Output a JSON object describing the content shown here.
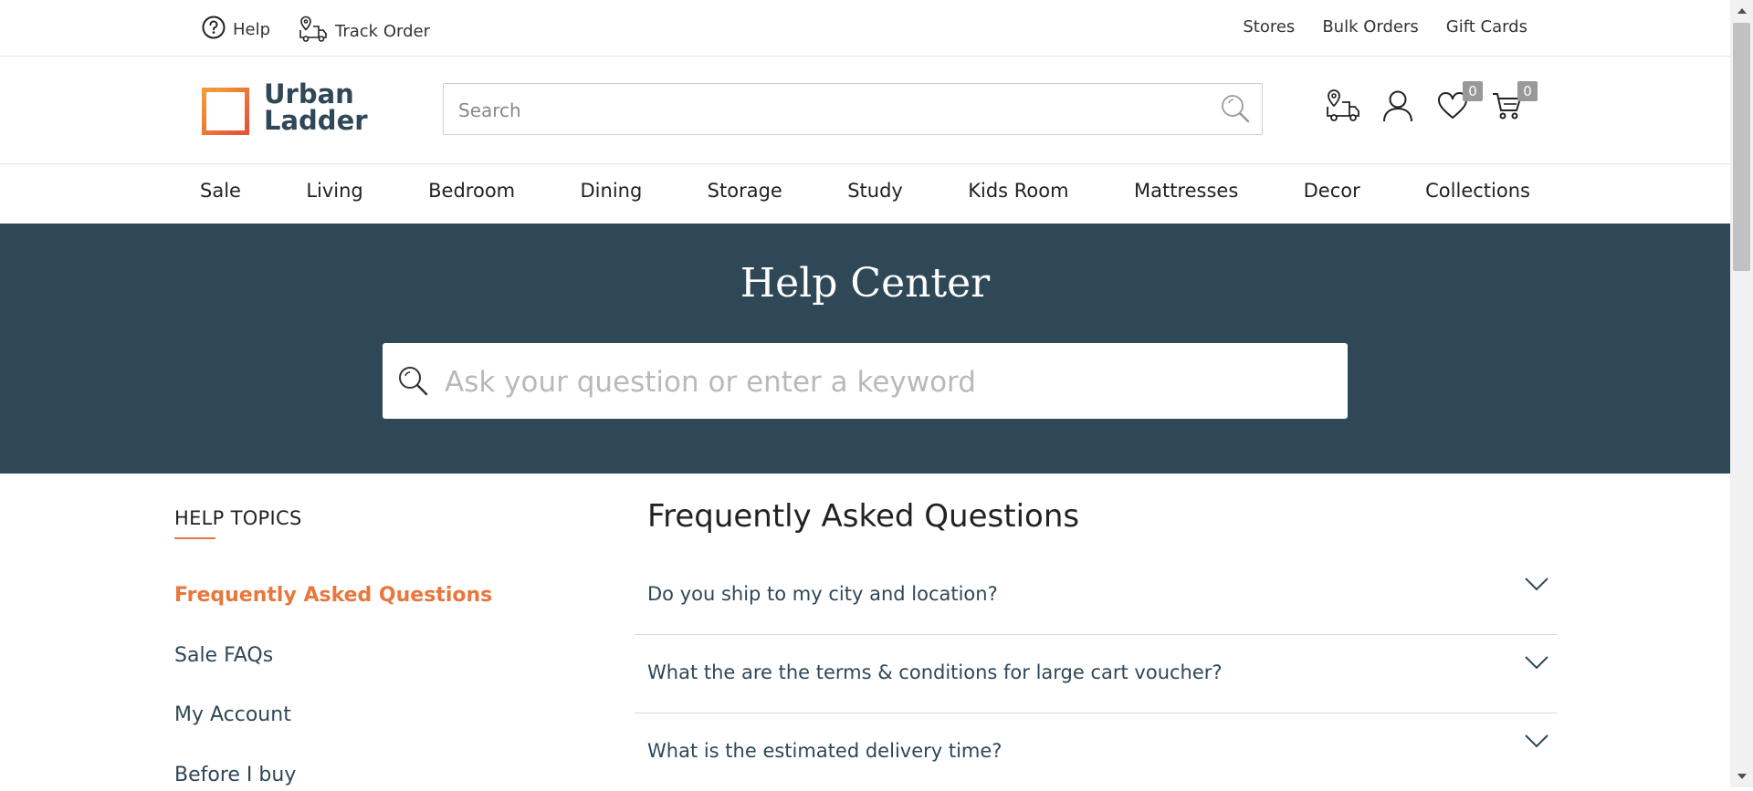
{
  "topbar": {
    "help_label": "Help",
    "track_order_label": "Track Order",
    "right_links": [
      "Stores",
      "Bulk Orders",
      "Gift Cards"
    ]
  },
  "header": {
    "logo_line1": "Urban",
    "logo_line2": "Ladder",
    "search_placeholder": "Search",
    "wishlist_count": "0",
    "cart_count": "0"
  },
  "nav": {
    "items": [
      "Sale",
      "Living",
      "Bedroom",
      "Dining",
      "Storage",
      "Study",
      "Kids Room",
      "Mattresses",
      "Decor",
      "Collections"
    ]
  },
  "hero": {
    "title": "Help Center",
    "search_placeholder": "Ask your question or enter a keyword"
  },
  "sidebar": {
    "title": "HELP TOPICS",
    "items": [
      "Frequently Asked Questions",
      "Sale FAQs",
      "My Account",
      "Before I buy"
    ],
    "active_index": 0
  },
  "main": {
    "title": "Frequently Asked Questions",
    "questions": [
      "Do you ship to my city and location?",
      "What the are the terms & conditions for large cart voucher?",
      "What is the estimated delivery time?"
    ]
  },
  "colors": {
    "accent": "#e8773d",
    "hero_bg": "#2f4858",
    "text_dark": "#2f4756"
  }
}
